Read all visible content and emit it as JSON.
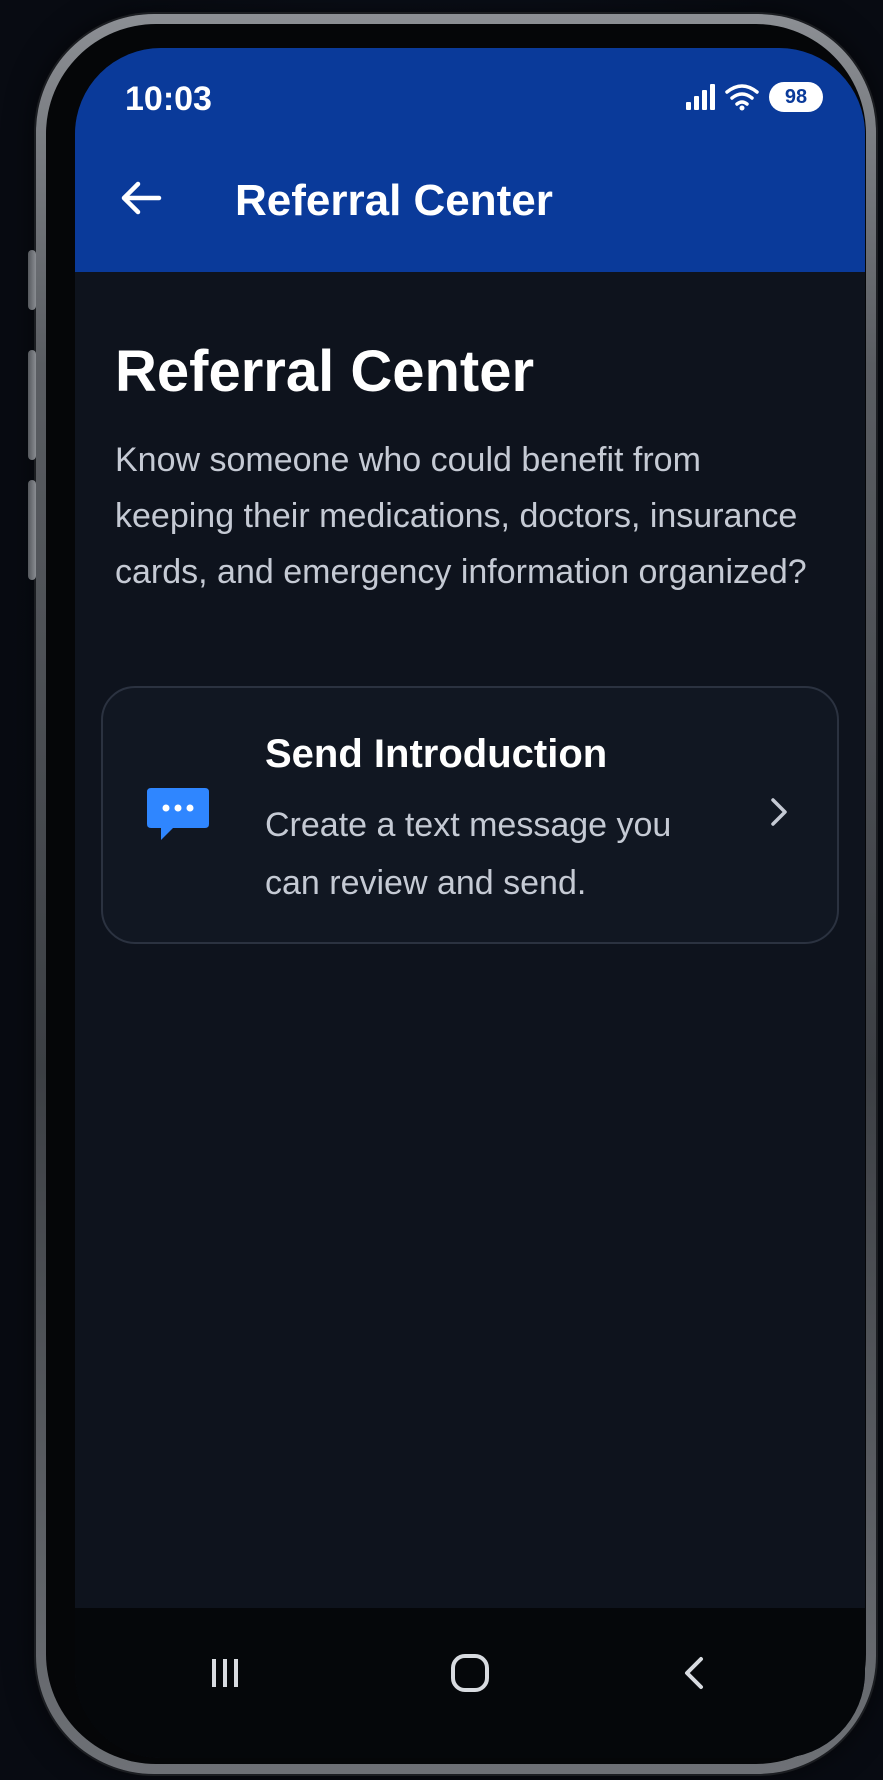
{
  "status_bar": {
    "time": "10:03",
    "battery": "98"
  },
  "app_bar": {
    "title": "Referral Center",
    "back_icon": "arrow-left-icon"
  },
  "main": {
    "title": "Referral Center",
    "description": "Know someone who could benefit from keeping their medications, doctors, insurance cards, and emergency information organized?"
  },
  "card": {
    "icon": "chat-bubble-icon",
    "title": "Send Introduction",
    "description": "Create a text message you can review and send.",
    "chevron_icon": "chevron-right-icon"
  },
  "nav_bar": {
    "items": [
      "recent-apps-icon",
      "home-icon",
      "back-icon"
    ]
  },
  "colors": {
    "app_bar": "#0a3a9a",
    "background": "#0e131d",
    "card_icon": "#2f86ff",
    "text_primary": "#ffffff",
    "text_secondary": "#c5cad4"
  }
}
